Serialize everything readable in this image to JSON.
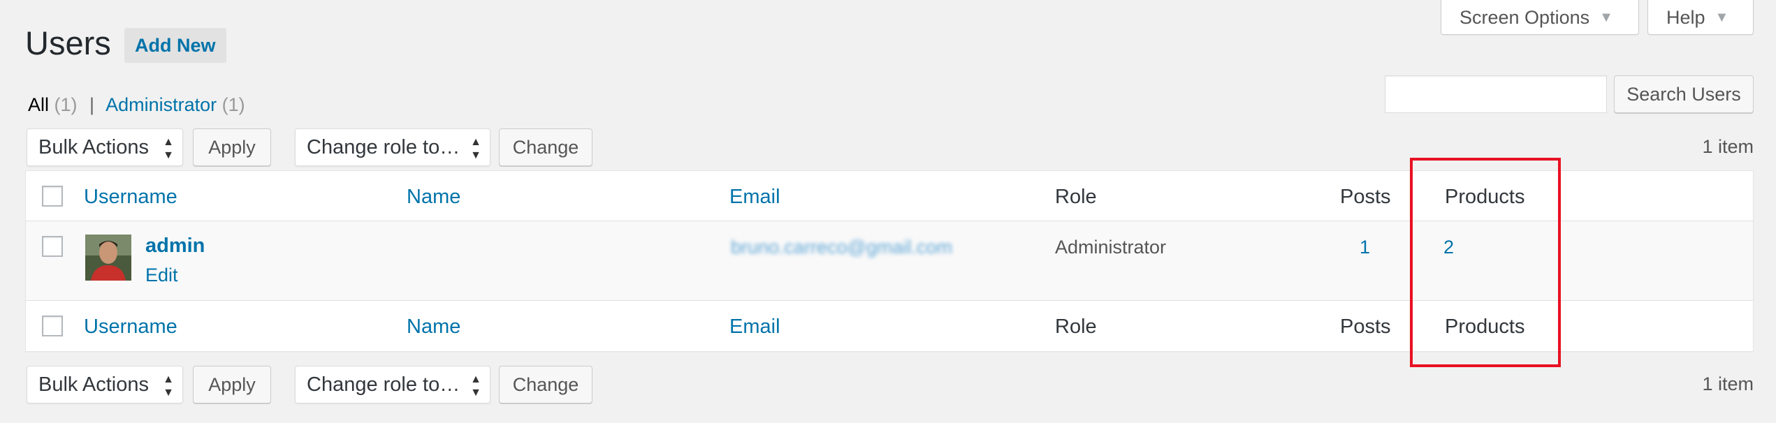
{
  "header": {
    "title": "Users",
    "add_new_label": "Add New",
    "screen_options_label": "Screen Options",
    "help_label": "Help"
  },
  "filters": {
    "all_label": "All",
    "all_count": "(1)",
    "separator": "|",
    "admin_label": "Administrator",
    "admin_count": "(1)"
  },
  "search": {
    "placeholder": "",
    "button_label": "Search Users"
  },
  "bulk": {
    "actions_select": "Bulk Actions",
    "apply_label": "Apply",
    "role_select": "Change role to…",
    "change_label": "Change",
    "item_count": "1 item"
  },
  "table": {
    "columns": {
      "username": "Username",
      "name": "Name",
      "email": "Email",
      "role": "Role",
      "posts": "Posts",
      "products": "Products"
    },
    "rows": [
      {
        "username": "admin",
        "edit_label": "Edit",
        "email": "bruno.carreco@gmail.com",
        "role": "Administrator",
        "posts": "1",
        "products": "2"
      }
    ]
  },
  "colors": {
    "link": "#0073aa",
    "highlight": "#e81123",
    "background": "#f1f1f1"
  },
  "icons": {
    "select_arrows": "up-down-arrows-icon",
    "dropdown_caret": "caret-down-icon"
  }
}
